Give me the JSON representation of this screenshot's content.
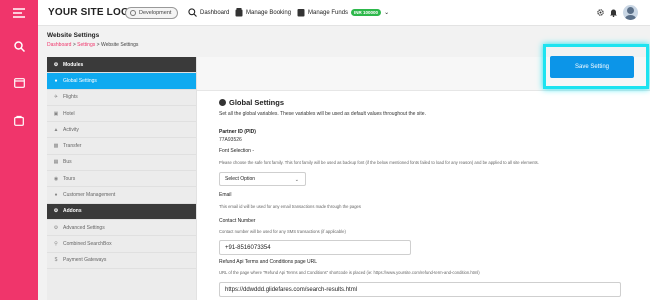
{
  "brand": {
    "logo_text": "YOUR SITE LOGO",
    "accent": "#f0356b",
    "primary": "#0c95e8",
    "highlight": "#1ee3f0"
  },
  "topbar": {
    "env_label": "Development",
    "nav": [
      {
        "label": "Dashboard",
        "icon": "search-icon"
      },
      {
        "label": "Manage Booking",
        "icon": "booking-icon"
      },
      {
        "label": "Manage Funds",
        "icon": "funds-icon",
        "badge": "INR 100000"
      }
    ]
  },
  "sidebar_rail": {
    "icons": [
      "menu-icon",
      "search-icon",
      "window-icon",
      "bag-icon"
    ]
  },
  "page": {
    "title": "Website Settings",
    "breadcrumb": [
      "Dashboard",
      "Settings",
      "Website Settings"
    ]
  },
  "menu": [
    {
      "label": "Modules",
      "type": "head",
      "icon": "gear-icon"
    },
    {
      "label": "Global Settings",
      "type": "active",
      "icon": "globe-icon"
    },
    {
      "label": "Flights",
      "type": "item",
      "icon": "plane-icon"
    },
    {
      "label": "Hotel",
      "type": "item",
      "icon": "bed-icon"
    },
    {
      "label": "Activity",
      "type": "item",
      "icon": "activity-icon"
    },
    {
      "label": "Transfer",
      "type": "item",
      "icon": "car-icon"
    },
    {
      "label": "Bus",
      "type": "item",
      "icon": "bus-icon"
    },
    {
      "label": "Tours",
      "type": "item",
      "icon": "tours-icon"
    },
    {
      "label": "Customer Management",
      "type": "item",
      "icon": "user-icon"
    },
    {
      "label": "Addons",
      "type": "head",
      "icon": "gear-icon"
    },
    {
      "label": "Advanced Settings",
      "type": "item",
      "icon": "gear-icon"
    },
    {
      "label": "Combined SearchBox",
      "type": "item",
      "icon": "search-icon"
    },
    {
      "label": "Payment Gateways",
      "type": "item",
      "icon": "dollar-icon"
    }
  ],
  "content": {
    "save_label": "Save Setting",
    "section_title": "Global Settings",
    "section_desc": "Set all the global variables. These variables will be used as default values throughout the site.",
    "partner_label": "Partner ID (PID)",
    "partner_value": "77A93526",
    "font_label": "Font Selection -",
    "font_help": "Please choose the safe font family. This font family will be used as backup font (if the below mentioned fonts failed to load for any reason) and be applied to all site elements.",
    "font_value": "Select Option",
    "email_label": "Email",
    "email_help": "This email id will be used for any email transactions made through the pages",
    "contact_label": "Contact Number",
    "contact_help": "Contact number will be used for any SMS transactions (if applicable)",
    "contact_value": "+91-8516073354",
    "refund_label": "Refund Api Terms and Conditions page URL",
    "refund_help": "URL of the page where \"Refund Api Terms and Conditions\" shortcode is placed (ie: https://www.yoursite.com/refund-term-and-condition.html)",
    "refund_value": "https://ddwddd.glidefares.com/search-results.html"
  }
}
